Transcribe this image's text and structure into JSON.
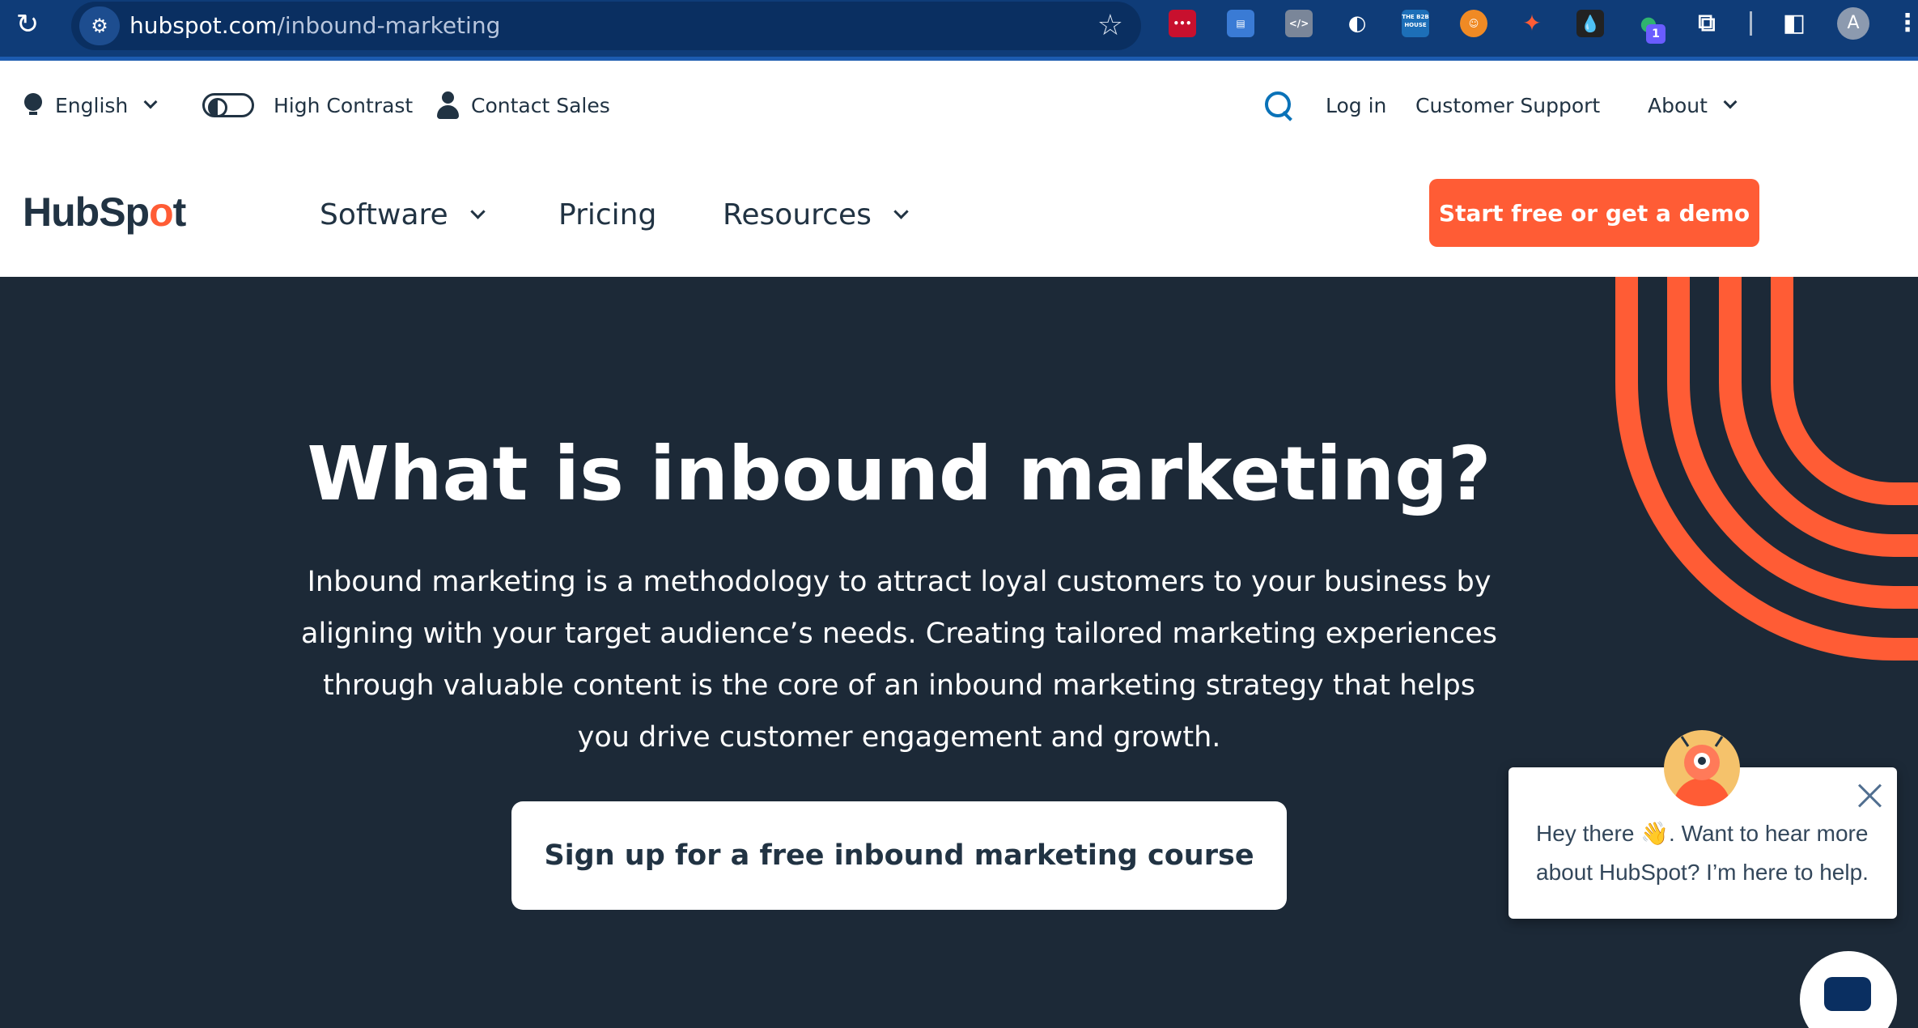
{
  "browser": {
    "url_host": "hubspot.com",
    "url_path": "/inbound-marketing",
    "extension_badge": "1",
    "extension_label_b2b": "THE B2B HOUSE",
    "profile_initial": "A"
  },
  "utility_nav": {
    "language": "English",
    "high_contrast": "High Contrast",
    "contact_sales": "Contact Sales",
    "login": "Log in",
    "customer_support": "Customer Support",
    "about": "About"
  },
  "main_nav": {
    "logo": "HubSpot",
    "software": "Software",
    "pricing": "Pricing",
    "resources": "Resources",
    "cta": "Start free or get a demo"
  },
  "hero": {
    "title": "What is inbound marketing?",
    "body": "Inbound marketing is a methodology to attract loyal customers to your business by aligning with your target audience’s needs. Creating tailored marketing experiences through valuable content is the core of an inbound marketing strategy that helps you drive customer engagement and growth.",
    "button": "Sign up for a free inbound marketing course"
  },
  "chat": {
    "message": "Hey there 👋. Want to hear more about HubSpot? I’m here to help."
  },
  "colors": {
    "brand_orange": "#ff5c35",
    "dark_navy": "#1c2937",
    "text_navy": "#213343",
    "browser_blue": "#0f3c78"
  }
}
